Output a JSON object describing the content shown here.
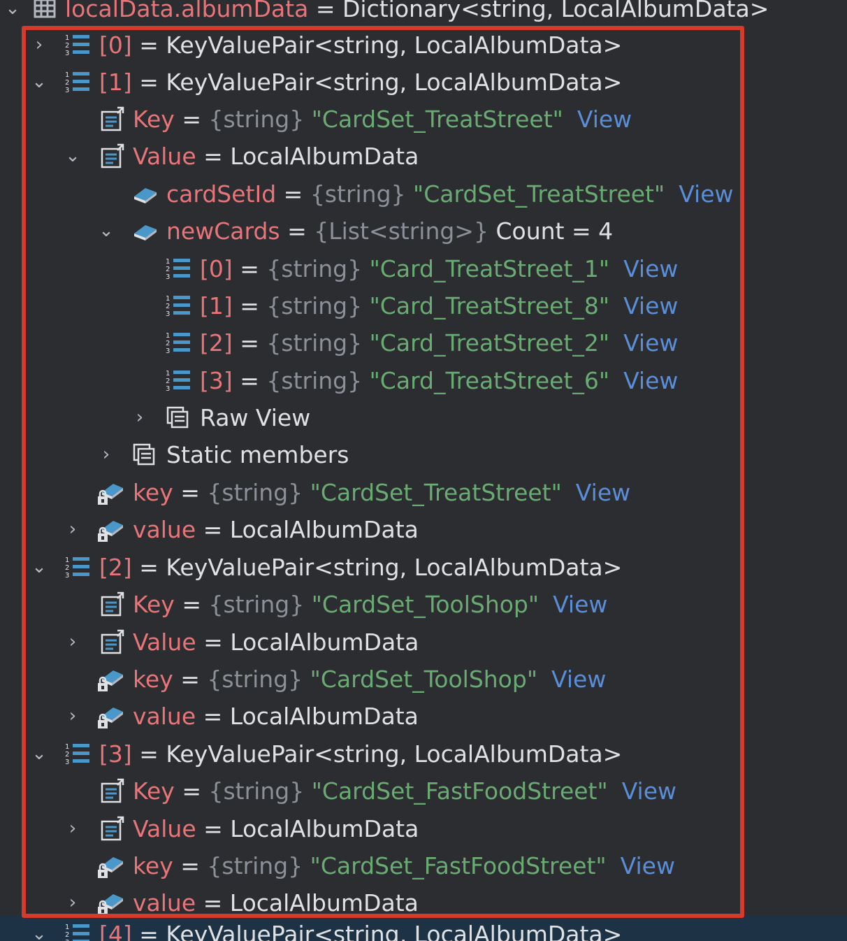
{
  "tree": {
    "rows": [
      {
        "name": "localData.albumData",
        "eq": " = ",
        "value": "Dictionary<string, LocalAlbumData>"
      },
      {
        "name": "[0]",
        "eq": " = ",
        "value": "KeyValuePair<string, LocalAlbumData>"
      },
      {
        "name": "[1]",
        "eq": " = ",
        "value": "KeyValuePair<string, LocalAlbumData>"
      },
      {
        "name": "Key",
        "eq": " = ",
        "type": "{string}",
        "value": "\"CardSet_TreatStreet\"",
        "view": "View"
      },
      {
        "name": "Value",
        "eq": " = ",
        "value": "LocalAlbumData"
      },
      {
        "name": "cardSetId",
        "eq": " = ",
        "type": "{string}",
        "value": "\"CardSet_TreatStreet\"",
        "view": "View"
      },
      {
        "name": "newCards",
        "eq": " = ",
        "type": "{List<string>}",
        "value": "Count = 4"
      },
      {
        "name": "[0]",
        "eq": " = ",
        "type": "{string}",
        "value": "\"Card_TreatStreet_1\"",
        "view": "View"
      },
      {
        "name": "[1]",
        "eq": " = ",
        "type": "{string}",
        "value": "\"Card_TreatStreet_8\"",
        "view": "View"
      },
      {
        "name": "[2]",
        "eq": " = ",
        "type": "{string}",
        "value": "\"Card_TreatStreet_2\"",
        "view": "View"
      },
      {
        "name": "[3]",
        "eq": " = ",
        "type": "{string}",
        "value": "\"Card_TreatStreet_6\"",
        "view": "View"
      },
      {
        "label": "Raw View"
      },
      {
        "label": "Static members"
      },
      {
        "name": "key",
        "eq": " = ",
        "type": "{string}",
        "value": "\"CardSet_TreatStreet\"",
        "view": "View"
      },
      {
        "name": "value",
        "eq": " = ",
        "value": "LocalAlbumData"
      },
      {
        "name": "[2]",
        "eq": " = ",
        "value": "KeyValuePair<string, LocalAlbumData>"
      },
      {
        "name": "Key",
        "eq": " = ",
        "type": "{string}",
        "value": "\"CardSet_ToolShop\"",
        "view": "View"
      },
      {
        "name": "Value",
        "eq": " = ",
        "value": "LocalAlbumData"
      },
      {
        "name": "key",
        "eq": " = ",
        "type": "{string}",
        "value": "\"CardSet_ToolShop\"",
        "view": "View"
      },
      {
        "name": "value",
        "eq": " = ",
        "value": "LocalAlbumData"
      },
      {
        "name": "[3]",
        "eq": " = ",
        "value": "KeyValuePair<string, LocalAlbumData>"
      },
      {
        "name": "Key",
        "eq": " = ",
        "type": "{string}",
        "value": "\"CardSet_FastFoodStreet\"",
        "view": "View"
      },
      {
        "name": "Value",
        "eq": " = ",
        "value": "LocalAlbumData"
      },
      {
        "name": "key",
        "eq": " = ",
        "type": "{string}",
        "value": "\"CardSet_FastFoodStreet\"",
        "view": "View"
      },
      {
        "name": "value",
        "eq": " = ",
        "value": "LocalAlbumData"
      },
      {
        "name": "[4]",
        "eq": " = ",
        "value": "KeyValuePair<string, LocalAlbumData>"
      }
    ]
  },
  "icons": {
    "dictionary": "table-icon",
    "list-item": "indexed-list-icon",
    "property": "property-icon",
    "field": "field-icon",
    "private-field": "locked-field-icon",
    "raw-view": "raw-view-icon",
    "static-members": "static-members-icon"
  },
  "colors": {
    "background": "#2b2d30",
    "member_name": "#e8757a",
    "type_hint": "#8c9098",
    "string_value": "#6aab73",
    "view_link": "#5a8ed8",
    "highlight_border": "#d53a2a",
    "selected_row": "#1d3345"
  }
}
